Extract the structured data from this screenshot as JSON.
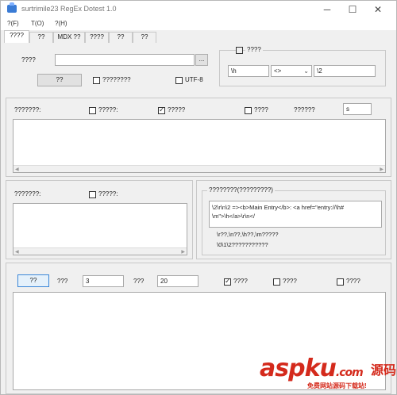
{
  "window": {
    "title": "surtrimile23 RegEx Dotest 1.0",
    "minimize": "─",
    "maximize": "☐",
    "close": "✕"
  },
  "menu": [
    "?(F)",
    "T(O)",
    "?(H)"
  ],
  "tabs": [
    "????",
    "??",
    "MDX ??",
    "????",
    "??",
    "??"
  ],
  "top": {
    "label": "????",
    "path_value": "",
    "browse_label": "...",
    "run_button": "??",
    "checkbox1_label": "????????",
    "utf8_label": "UTF-8",
    "group_checkbox_label": "????",
    "field_left": "\\h",
    "select_value": "<>",
    "field_right": "\\2"
  },
  "mid": {
    "label": "???????:",
    "cb1": "?????:",
    "cb2": "?????",
    "cb3": "????",
    "label2": "??????",
    "field_value": "s"
  },
  "left2": {
    "label": "???????:",
    "cb": "?????:"
  },
  "right2": {
    "group_title": "????????(?????????)",
    "box_line1": "\\2\\r\\n\\2 =><b>Main Entry</b>: <a href=\"entry://\\h#",
    "box_line2": "\\m\">\\h</a>\\r\\n</",
    "text1": "\\r??,\\n??,\\h??,\\m?????",
    "text2": "\\0\\1\\2???????????"
  },
  "bottom": {
    "button": "??",
    "label1": "???",
    "value1": "3",
    "label2": "???",
    "value2": "20",
    "cb1": "????",
    "cb2": "????",
    "cb3": "????"
  },
  "watermark": {
    "logo": "aspku",
    "suffix": ".com",
    "cn": "源码",
    "sub": "免费网站源码下载站!"
  }
}
